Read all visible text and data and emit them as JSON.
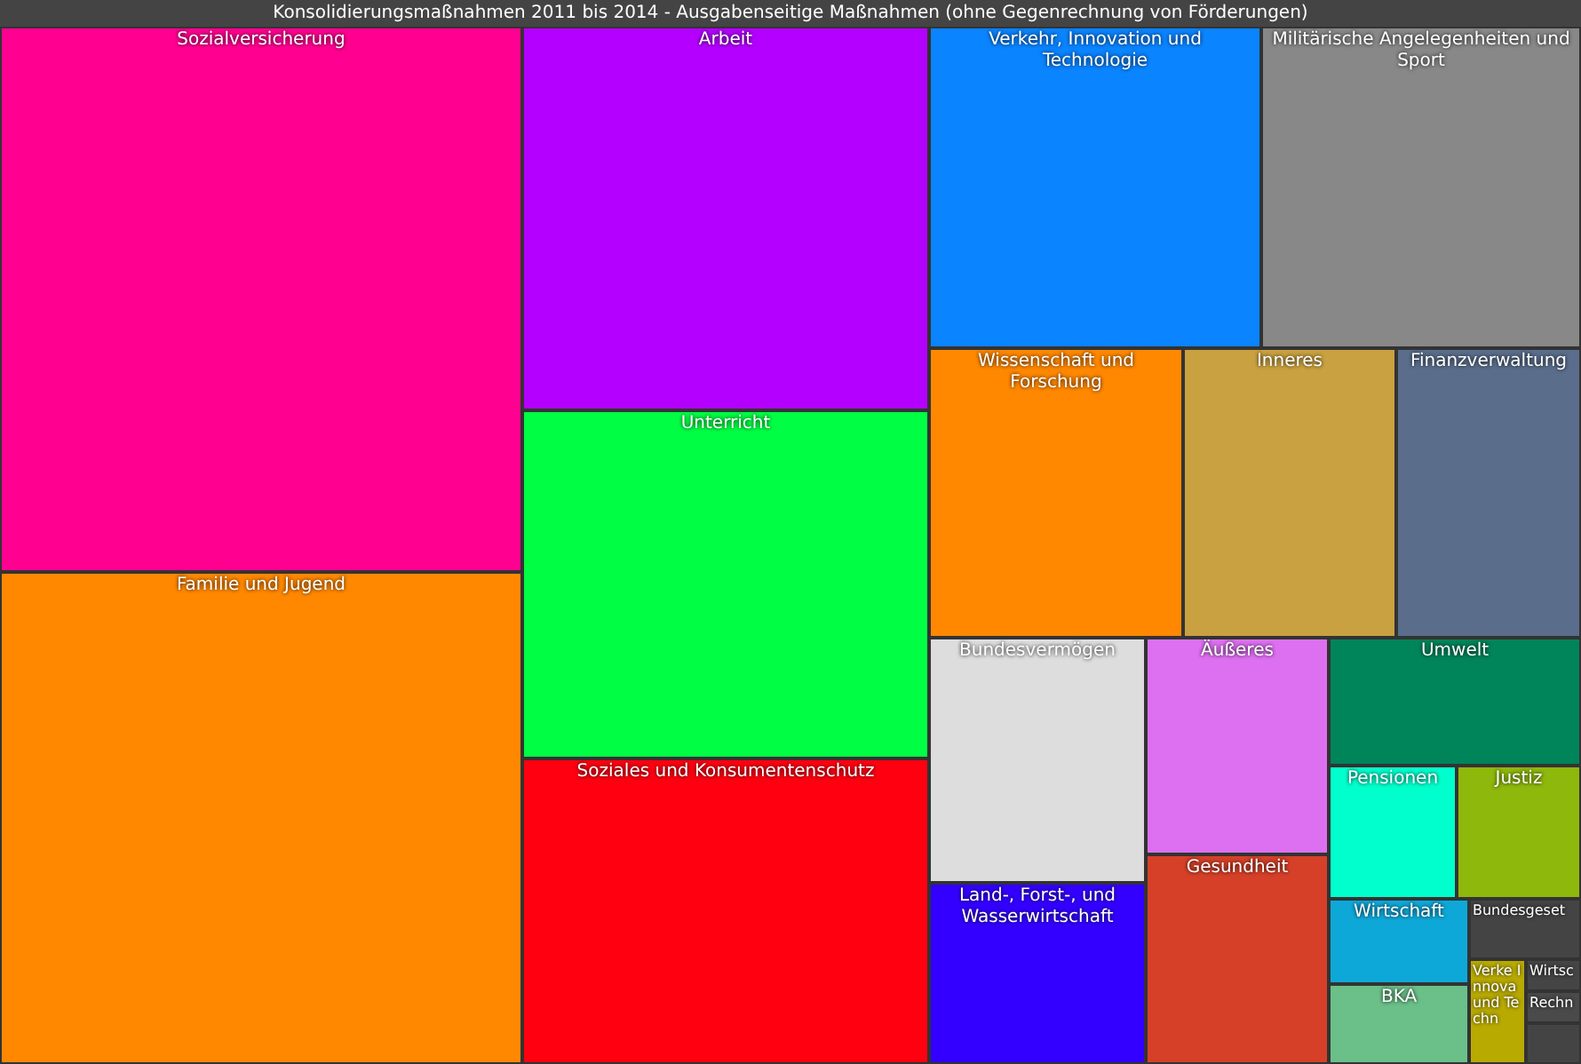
{
  "title": "Konsolidierungsmaßnahmen 2011 bis 2014 - Ausgabenseitige Maßnahmen (ohne Gegenrechnung von Förderungen)",
  "cells": [
    {
      "label": "Sozialversicherung",
      "color": "#ff0090"
    },
    {
      "label": "Familie und Jugend",
      "color": "#ff8800"
    },
    {
      "label": "Arbeit",
      "color": "#b400ff"
    },
    {
      "label": "Unterricht",
      "color": "#00ff44"
    },
    {
      "label": "Soziales und Konsumentenschutz",
      "color": "#ff0011"
    },
    {
      "label": "Verkehr, Innovation und Technologie",
      "color": "#0a84ff"
    },
    {
      "label": "Militärische Angelegenheiten und Sport",
      "color": "#888888"
    },
    {
      "label": "Wissenschaft und Forschung",
      "color": "#ff8800"
    },
    {
      "label": "Inneres",
      "color": "#c9a140"
    },
    {
      "label": "Finanzverwaltung",
      "color": "#5a6e8c"
    },
    {
      "label": "Bundesvermögen",
      "color": "#dddddd"
    },
    {
      "label": "Land-, Forst-, und Wasserwirtschaft",
      "color": "#3300ff"
    },
    {
      "label": "Äußeres",
      "color": "#dd70f0"
    },
    {
      "label": "Gesundheit",
      "color": "#d64028"
    },
    {
      "label": "Umwelt",
      "color": "#00845a"
    },
    {
      "label": "Pensionen",
      "color": "#00ffcc"
    },
    {
      "label": "Justiz",
      "color": "#8fb80c"
    },
    {
      "label": "Wirtschaft",
      "color": "#0ea8d8"
    },
    {
      "label": "BKA",
      "color": "#6bbf88"
    },
    {
      "label": "Bundesgeset",
      "color": "#444444"
    },
    {
      "label": "Verke Innova und Techn",
      "color": "#b8aa00"
    },
    {
      "label": "Wirtsc",
      "color": "#454545"
    },
    {
      "label": "Rechn",
      "color": "#4a4a4a"
    }
  ]
}
